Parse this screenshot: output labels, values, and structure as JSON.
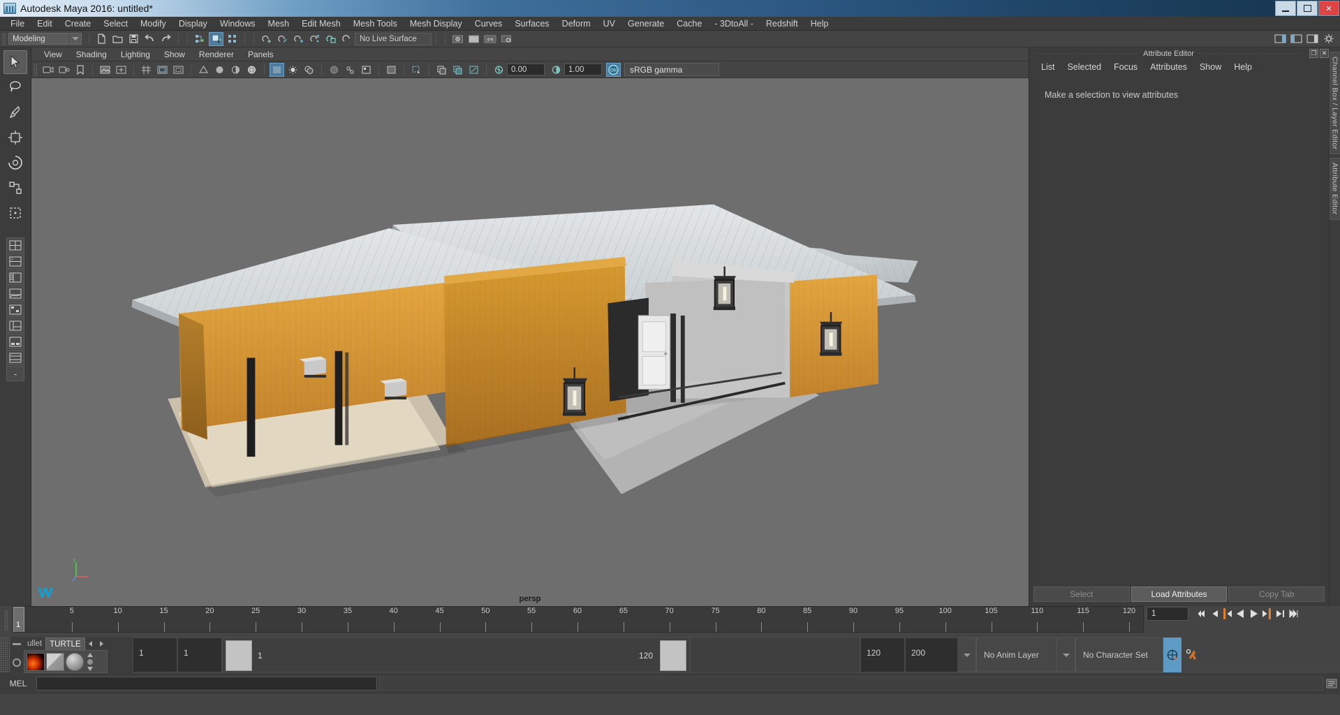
{
  "window": {
    "title": "Autodesk Maya 2016: untitled*",
    "icon": "maya-app-icon",
    "buttons": {
      "minimize": "minimize-button",
      "maximize": "maximize-button",
      "close": "close-button"
    }
  },
  "menubar": {
    "items": [
      "File",
      "Edit",
      "Create",
      "Select",
      "Modify",
      "Display",
      "Windows",
      "Mesh",
      "Edit Mesh",
      "Mesh Tools",
      "Mesh Display",
      "Curves",
      "Surfaces",
      "Deform",
      "UV",
      "Generate",
      "Cache",
      "- 3DtoAll -",
      "Redshift",
      "Help"
    ]
  },
  "statusbar": {
    "menuset": "Modeling",
    "live_surface": "No Live Surface",
    "numeric_fields": [],
    "icons": [
      "new-scene-icon",
      "open-scene-icon",
      "save-scene-icon",
      "undo-icon",
      "redo-icon",
      "select-by-hierarchy-icon",
      "select-by-object-icon",
      "select-by-component-icon",
      "snap-to-grid-icon",
      "snap-to-curve-icon",
      "snap-to-point-icon",
      "snap-to-projected-center-icon",
      "snap-to-view-plane-icon",
      "make-live-icon",
      "render-view-icon",
      "render-current-frame-icon",
      "ipr-render-icon",
      "render-settings-icon"
    ]
  },
  "viewport": {
    "panel_menu": [
      "View",
      "Shading",
      "Lighting",
      "Show",
      "Renderer",
      "Panels"
    ],
    "camera_label": "persp",
    "toolbar": {
      "exposure_value": "0.00",
      "gamma_value": "1.00",
      "color_management": "sRGB gamma",
      "cm_toggle": "ON",
      "icons": [
        "select-tool-icon",
        "lasso-icon",
        "paint-select-icon",
        "wireframe-icon",
        "smooth-shade-icon",
        "flat-shade-icon",
        "shaded-wireframe-icon",
        "textured-icon",
        "use-default-lighting-icon",
        "shadows-icon",
        "ambient-occlusion-icon",
        "motion-blur-icon",
        "multisample-icon",
        "xray-icon",
        "xray-joints-icon",
        "isolate-select-icon",
        "grid-toggle-icon",
        "film-gate-icon",
        "resolution-gate-icon",
        "exposure-icon",
        "gamma-icon"
      ]
    },
    "gizmo": {
      "axis_y": "y",
      "axis_x": "x",
      "axis_z": "z"
    }
  },
  "toolbox": {
    "tools": [
      "select-tool",
      "lasso-select-tool",
      "paint-select-tool",
      "move-tool",
      "rotate-tool",
      "scale-tool",
      "last-tool"
    ],
    "layouts": [
      "single-perspective-layout",
      "four-view-layout",
      "outliner-persp-layout",
      "persp-graph-layout",
      "hypershade-persp-layout",
      "outliner-persp-graph-layout",
      "persp-trax-layout",
      "two-pane-stacked-layout"
    ],
    "recent": "-"
  },
  "attribute_editor": {
    "title": "Attribute Editor",
    "menu": [
      "List",
      "Selected",
      "Focus",
      "Attributes",
      "Show",
      "Help"
    ],
    "empty_message": "Make a selection to view attributes",
    "footer": {
      "select": "Select",
      "load": "Load Attributes",
      "copy": "Copy Tab"
    },
    "header_buttons": [
      "undock-icon",
      "close-icon"
    ]
  },
  "right_tabs": [
    "Channel Box / Layer Editor",
    "Attribute Editor"
  ],
  "timeline": {
    "start_label": "1",
    "ticks": [
      5,
      10,
      15,
      20,
      25,
      30,
      35,
      40,
      45,
      50,
      55,
      60,
      65,
      70,
      75,
      80,
      85,
      90,
      95,
      100,
      105,
      110,
      115,
      120
    ],
    "end_label": "120",
    "current_frame": "1",
    "playhead_frame": "1",
    "playback_buttons": [
      "go-to-start-icon",
      "step-back-keyframe-icon",
      "step-back-frame-icon",
      "play-backwards-icon",
      "play-forwards-icon",
      "step-forward-frame-icon",
      "step-forward-keyframe-icon",
      "go-to-end-icon"
    ]
  },
  "range_slider": {
    "anim_start": "1",
    "anim_end": "1",
    "range_start": "1",
    "range_end": "120",
    "playback_end": "120",
    "anim_total_end": "200",
    "anim_layer": "No Anim Layer",
    "character_set": "No Character Set",
    "icons": [
      "auto-key-icon",
      "animation-preferences-icon"
    ]
  },
  "shelf": {
    "tabs": [
      "ullet",
      "TURTLE"
    ],
    "selected_tab": "TURTLE",
    "arrows": [
      "shelf-prev-icon",
      "shelf-next-icon"
    ],
    "items": [
      "turtle-render-icon",
      "turtle-bake-icon",
      "turtle-sphere-icon"
    ]
  },
  "command_line": {
    "label": "MEL",
    "input_value": "",
    "output_value": ""
  },
  "colors": {
    "title_gradient_start": "#dfeaf5",
    "title_gradient_end": "#16344d",
    "panel_bg": "#3c3c3c",
    "toolbar_bg": "#444444",
    "viewport_bg": "#6e6e6e",
    "accent_blue": "#4f7c9e",
    "wood": "#d09233",
    "roof": "#d2d6d8",
    "orange_marker": "#e08030"
  }
}
